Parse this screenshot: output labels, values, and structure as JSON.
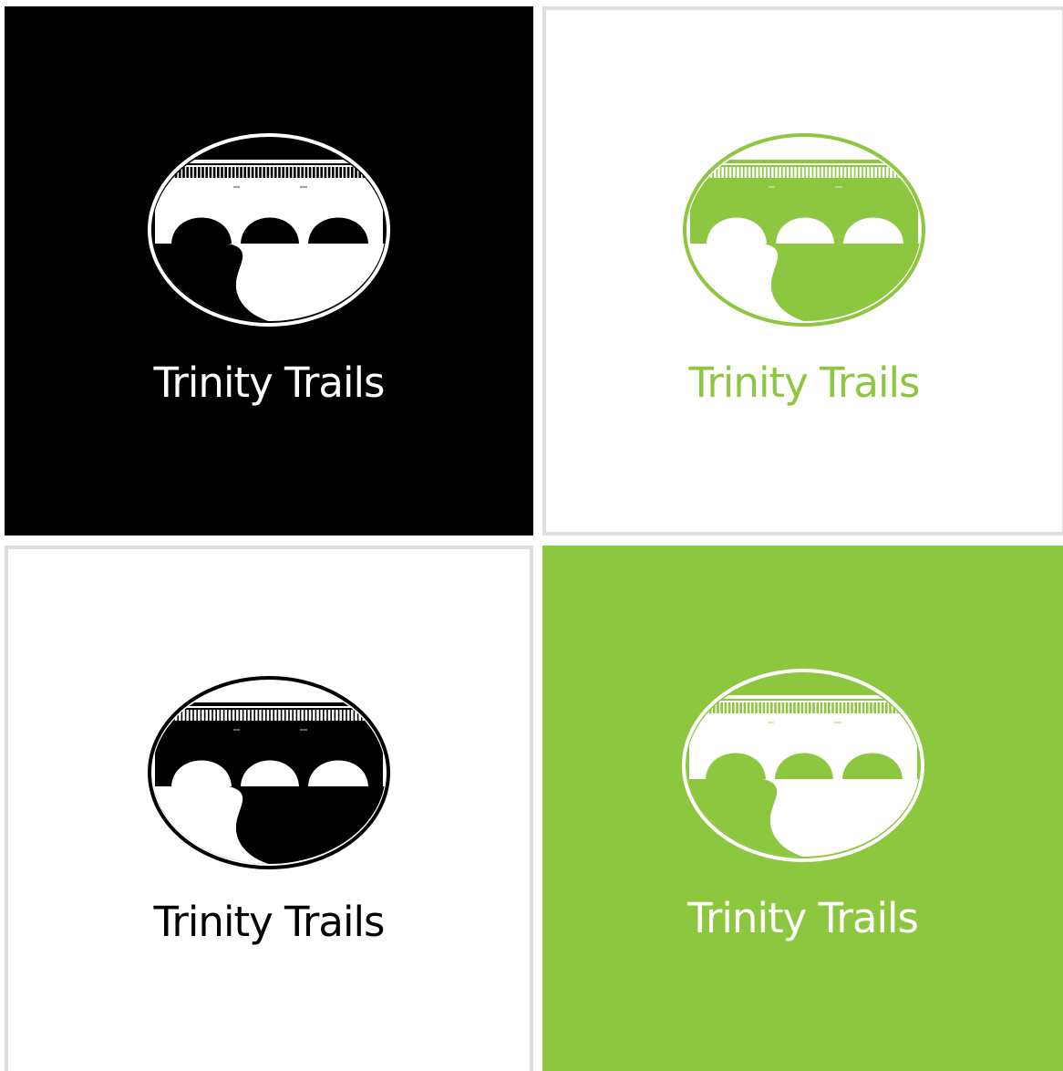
{
  "panels": [
    {
      "name": "black-variant",
      "background": "#000000",
      "logo_color": "#ffffff",
      "logo_fill": "#ffffff",
      "text_color": "#ffffff",
      "wordmark": "Trinity Trails"
    },
    {
      "name": "white-green-variant",
      "background": "#ffffff",
      "logo_color": "#8dc63f",
      "logo_fill": "#8dc63f",
      "text_color": "#8dc63f",
      "wordmark": "Trinity Trails"
    },
    {
      "name": "white-black-variant",
      "background": "#ffffff",
      "logo_color": "#000000",
      "logo_fill": "#000000",
      "text_color": "#000000",
      "wordmark": "Trinity Trails"
    },
    {
      "name": "green-variant",
      "background": "#8dc63f",
      "logo_color": "#ffffff",
      "logo_fill": "#ffffff",
      "text_color": "#ffffff",
      "wordmark": "Trinity Trails"
    }
  ],
  "colors": {
    "brand_green": "#8dc63f",
    "black": "#000000",
    "white": "#ffffff",
    "frame_gray": "#dedede"
  },
  "icons": [
    "bridge-river-logo"
  ]
}
